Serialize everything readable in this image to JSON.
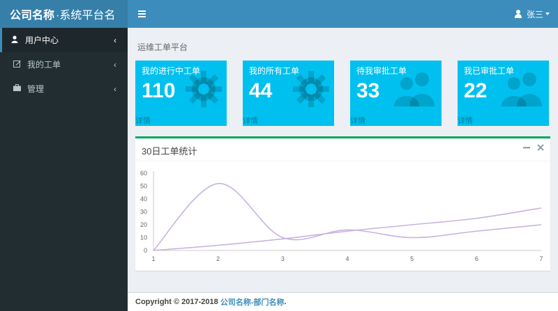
{
  "header": {
    "company": "公司名称",
    "system": "·系统平台名",
    "menu_icon": "hamburger-icon",
    "user_name": "张三"
  },
  "sidebar": {
    "items": [
      {
        "label": "用户中心",
        "icon": "user-icon",
        "active": true
      },
      {
        "label": "我的工单",
        "icon": "edit-icon",
        "active": false
      },
      {
        "label": "管理",
        "icon": "briefcase-icon",
        "active": false
      }
    ]
  },
  "page": {
    "title": "运维工单平台"
  },
  "tiles": [
    {
      "title": "我的进行中工单",
      "value": "110",
      "more": "详情",
      "icon": "gear-icon"
    },
    {
      "title": "我的所有工单",
      "value": "44",
      "more": "详情",
      "icon": "gear-icon"
    },
    {
      "title": "待我审批工单",
      "value": "33",
      "more": "详情",
      "icon": "users-icon"
    },
    {
      "title": "我已审批工单",
      "value": "22",
      "more": "详情",
      "icon": "users-icon"
    }
  ],
  "chart_box": {
    "title": "30日工单统计",
    "collapse_icon": "minus-icon",
    "close_icon": "close-icon"
  },
  "chart_data": {
    "type": "line",
    "x": [
      1,
      2,
      3,
      4,
      5,
      6,
      7
    ],
    "ylim": [
      0,
      60
    ],
    "yticks": [
      0,
      10,
      20,
      30,
      40,
      50,
      60
    ],
    "grid": false,
    "series": [
      {
        "values": [
          0,
          52,
          10,
          16,
          10,
          15,
          20
        ],
        "color": "#c7b3e0"
      },
      {
        "values": [
          0,
          4,
          9,
          15,
          20,
          25,
          33
        ],
        "color": "#c7b3e0"
      }
    ]
  },
  "footer": {
    "copyright": "Copyright © 2017-2018",
    "org": "公司名称-部门名称",
    "period": "."
  },
  "colors": {
    "topbar": "#3c8dbc",
    "logo": "#367fa9",
    "sidebar": "#222d32",
    "tile": "#00c0ef",
    "box_border": "#00a65a",
    "line": "#c7b3e0"
  }
}
